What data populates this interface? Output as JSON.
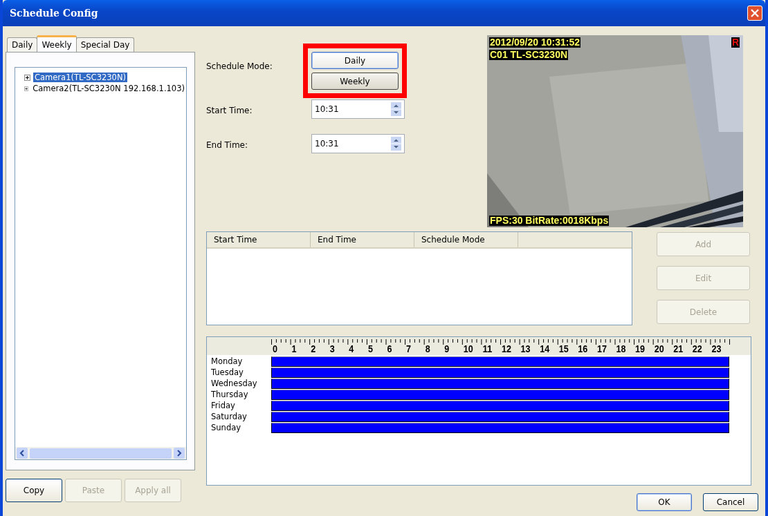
{
  "window": {
    "title": "Schedule Config"
  },
  "tabs": [
    {
      "label": "Daily",
      "selected": false
    },
    {
      "label": "Weekly",
      "selected": true
    },
    {
      "label": "Special Day",
      "selected": false
    }
  ],
  "tree": [
    {
      "label": "Camera1(TL-SC3230N)",
      "selected": true,
      "expanded": false
    },
    {
      "label": "Camera2(TL-SC3230N 192.168.1.103)",
      "selected": false,
      "expanded": false
    }
  ],
  "left_buttons": [
    {
      "label": "Copy",
      "disabled": false
    },
    {
      "label": "Paste",
      "disabled": true
    },
    {
      "label": "Apply all",
      "disabled": true
    }
  ],
  "schedule_mode": {
    "label": "Schedule Mode:",
    "options": [
      {
        "label": "Daily",
        "selected": true
      },
      {
        "label": "Weekly",
        "selected": false
      }
    ]
  },
  "start_time": {
    "label": "Start Time:",
    "value": "10:31"
  },
  "end_time": {
    "label": "End Time:",
    "value": "10:31"
  },
  "video": {
    "timestamp": "2012/09/20 10:31:52",
    "camera": "C01 TL-SC3230N",
    "record_mark": "R",
    "stats": "FPS:30 BitRate:0018Kbps"
  },
  "table": {
    "columns": [
      "Start Time",
      "End Time",
      "Schedule Mode"
    ]
  },
  "action_buttons": [
    {
      "label": "Add",
      "disabled": true
    },
    {
      "label": "Edit",
      "disabled": true
    },
    {
      "label": "Delete",
      "disabled": true
    }
  ],
  "timeline": {
    "hours": [
      "0",
      "1",
      "2",
      "3",
      "4",
      "5",
      "6",
      "7",
      "8",
      "9",
      "10",
      "11",
      "12",
      "13",
      "14",
      "15",
      "16",
      "17",
      "18",
      "19",
      "20",
      "21",
      "22",
      "23"
    ],
    "days": [
      {
        "label": "Monday"
      },
      {
        "label": "Tuesday"
      },
      {
        "label": "Wednesday"
      },
      {
        "label": "Thursday"
      },
      {
        "label": "Friday"
      },
      {
        "label": "Saturday"
      },
      {
        "label": "Sunday"
      }
    ]
  },
  "dialog_buttons": [
    {
      "label": "OK",
      "selected": true
    },
    {
      "label": "Cancel",
      "selected": false
    }
  ]
}
